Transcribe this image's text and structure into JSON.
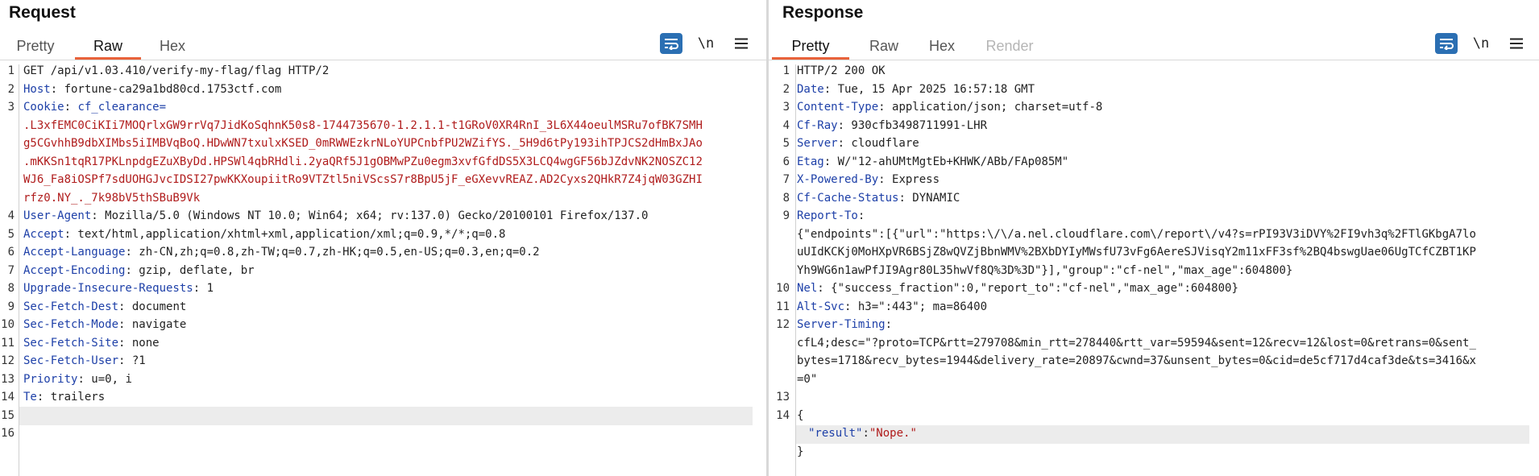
{
  "request": {
    "title": "Request",
    "tabs": [
      "Pretty",
      "Raw",
      "Hex"
    ],
    "active_tab": "Raw",
    "wrap_icon": "word-wrap-icon",
    "newline_toggle": "\\n",
    "menu_icon": "hamburger-menu-icon",
    "line_numbers": [
      "1",
      "2",
      "3",
      "4",
      "5",
      "6",
      "7",
      "8",
      "9",
      "10",
      "11",
      "12",
      "13",
      "14",
      "15",
      "16"
    ],
    "lines": {
      "l1": "GET /api/v1.03.410/verify-my-flag/flag HTTP/2",
      "l2_name": "Host",
      "l2_value": ": fortune-ca29a1bd80cd.1753ctf.com",
      "l3_name": "Cookie",
      "l3_sep": ": ",
      "l3_key": "cf_clearance",
      "l3_eq": "=",
      "cookie_value_lines": [
        ".L3xfEMC0CiKIi7MOQrlxGW9rrVq7JidKoSqhnK50s8-1744735670-1.2.1.1-t1GRoV0XR4RnI_3L6X44oeulMSRu7ofBK7SMH",
        "g5CGvhhB9dbXIMbs5iIMBVqBoQ.HDwWN7txulxKSED_0mRWWEzkrNLoYUPCnbfPU2WZifYS._5H9d6tPy193ihTPJCS2dHmBxJAo",
        ".mKKSn1tqR17PKLnpdgEZuXByDd.HPSWl4qbRHdli.2yaQRf5J1gOBMwPZu0egm3xvfGfdDS5X3LCQ4wgGF56bJZdvNK2NOSZC12",
        "WJ6_Fa8iOSPf7sdUOHGJvcIDSI27pwKKXoupiitRo9VTZtl5niVScsS7r8BpU5jF_eGXevvREAZ.AD2Cyxs2QHkR7Z4jqW03GZHI",
        "rfz0.NY_._7k98bV5thSBuB9Vk"
      ],
      "l4_name": "User-Agent",
      "l4_value": ": Mozilla/5.0 (Windows NT 10.0; Win64; x64; rv:137.0) Gecko/20100101 Firefox/137.0",
      "l5_name": "Accept",
      "l5_value": ": text/html,application/xhtml+xml,application/xml;q=0.9,*/*;q=0.8",
      "l6_name": "Accept-Language",
      "l6_value": ": zh-CN,zh;q=0.8,zh-TW;q=0.7,zh-HK;q=0.5,en-US;q=0.3,en;q=0.2",
      "l7_name": "Accept-Encoding",
      "l7_value": ": gzip, deflate, br",
      "l8_name": "Upgrade-Insecure-Requests",
      "l8_value": ": 1",
      "l9_name": "Sec-Fetch-Dest",
      "l9_value": ": document",
      "l10_name": "Sec-Fetch-Mode",
      "l10_value": ": navigate",
      "l11_name": "Sec-Fetch-Site",
      "l11_value": ": none",
      "l12_name": "Sec-Fetch-User",
      "l12_value": ": ?1",
      "l13_name": "Priority",
      "l13_value": ": u=0, i",
      "l14_name": "Te",
      "l14_value": ": trailers"
    }
  },
  "response": {
    "title": "Response",
    "tabs": [
      "Pretty",
      "Raw",
      "Hex",
      "Render"
    ],
    "active_tab": "Pretty",
    "disabled_tab": "Render",
    "wrap_icon": "word-wrap-icon",
    "newline_toggle": "\\n",
    "menu_icon": "hamburger-menu-icon",
    "line_numbers": [
      "1",
      "2",
      "3",
      "4",
      "5",
      "6",
      "7",
      "8",
      "9",
      "10",
      "11",
      "12",
      "13",
      "14"
    ],
    "lines": {
      "l1": "HTTP/2 200 OK",
      "l2_name": "Date",
      "l2_value": ": Tue, 15 Apr 2025 16:57:18 GMT",
      "l3_name": "Content-Type",
      "l3_value": ": application/json; charset=utf-8",
      "l4_name": "Cf-Ray",
      "l4_value": ": 930cfb3498711991-LHR",
      "l5_name": "Server",
      "l5_value": ": cloudflare",
      "l6_name": "Etag",
      "l6_value": ": W/\"12-ahUMtMgtEb+KHWK/ABb/FAp085M\"",
      "l7_name": "X-Powered-By",
      "l7_value": ": Express",
      "l8_name": "Cf-Cache-Status",
      "l8_value": ": DYNAMIC",
      "l9_name": "Report-To",
      "l9_value": ":",
      "l9_cont": [
        "{\"endpoints\":[{\"url\":\"https:\\/\\/a.nel.cloudflare.com\\/report\\/v4?s=rPI93V3iDVY%2FI9vh3q%2FTlGKbgA7lo",
        "uUIdKCKj0MoHXpVR6BSjZ8wQVZjBbnWMV%2BXbDYIyMWsfU73vFg6AereSJVisqY2m11xFF3sf%2BQ4bswgUae06UgTCfCZBT1KP",
        "Yh9WG6n1awPfJI9Agr80L35hwVf8Q%3D%3D\"}],\"group\":\"cf-nel\",\"max_age\":604800}"
      ],
      "l10_name": "Nel",
      "l10_value": ": {\"success_fraction\":0,\"report_to\":\"cf-nel\",\"max_age\":604800}",
      "l11_name": "Alt-Svc",
      "l11_value": ": h3=\":443\"; ma=86400",
      "l12_name": "Server-Timing",
      "l12_value": ":",
      "l12_cont": [
        "cfL4;desc=\"?proto=TCP&rtt=279708&min_rtt=278440&rtt_var=59594&sent=12&recv=12&lost=0&retrans=0&sent_",
        "bytes=1718&recv_bytes=1944&delivery_rate=20897&cwnd=37&unsent_bytes=0&cid=de5cf717d4caf3de&ts=3416&x",
        "=0\""
      ],
      "open_brace": "{",
      "json_key": "\"result\"",
      "json_colon": ":",
      "json_value": "\"Nope.\"",
      "close_brace": "}"
    }
  },
  "colors": {
    "header_name": "#1e40a8",
    "cookie_value": "#b01c1c",
    "active_tab_underline": "#e8623a",
    "wrap_button": "#2b6fb3"
  }
}
